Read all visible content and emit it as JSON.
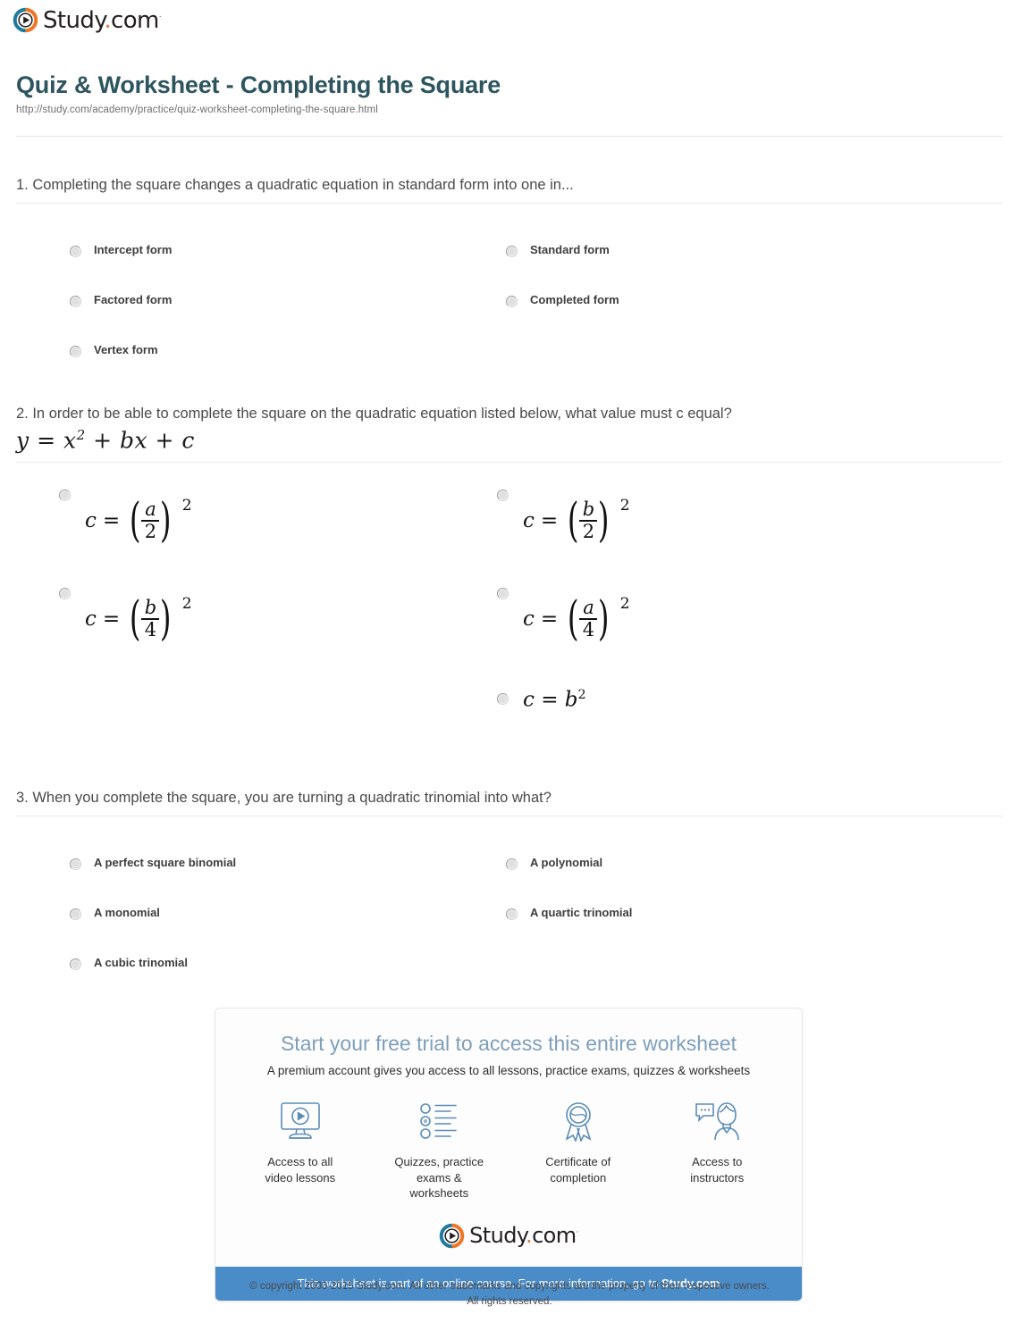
{
  "brand": {
    "name": "Study.com",
    "name_main": "Study",
    "name_dot": ".",
    "name_tld": "com",
    "trademark": "·",
    "logo_ring_left_color": "#1f7a9c",
    "logo_ring_right_color": "#ee7624",
    "logo_play_color": "#231f20"
  },
  "header": {
    "title": "Quiz & Worksheet - Completing the Square",
    "url": "http://study.com/academy/practice/quiz-worksheet-completing-the-square.html",
    "title_color": "#2d555e"
  },
  "questions": [
    {
      "number": "1.",
      "text": "1. Completing the square changes a quadratic equation in standard form into one in...",
      "options": [
        {
          "label": "Intercept form"
        },
        {
          "label": "Standard form"
        },
        {
          "label": "Factored form"
        },
        {
          "label": "Completed form"
        },
        {
          "label": "Vertex form"
        }
      ]
    },
    {
      "number": "2.",
      "text": "2. In order to be able to complete the square on the quadratic equation listed below, what value must c equal?",
      "equation": {
        "lhs": "y = x",
        "exponent": "2",
        "rhs": " + bx + c"
      },
      "math_options": [
        {
          "lhs": "c",
          "op": "=",
          "num": "a",
          "den": "2",
          "exp": "2",
          "kind": "fraction"
        },
        {
          "lhs": "c",
          "op": "=",
          "num": "b",
          "den": "2",
          "exp": "2",
          "kind": "fraction"
        },
        {
          "lhs": "c",
          "op": "=",
          "num": "b",
          "den": "4",
          "exp": "2",
          "kind": "fraction"
        },
        {
          "lhs": "c",
          "op": "=",
          "num": "a",
          "den": "4",
          "exp": "2",
          "kind": "fraction"
        },
        {
          "lhs": "c",
          "op": "=",
          "base": "b",
          "exp": "2",
          "kind": "power"
        }
      ]
    },
    {
      "number": "3.",
      "text": "3. When you complete the square, you are turning a quadratic trinomial into what?",
      "options": [
        {
          "label": "A perfect square binomial"
        },
        {
          "label": "A polynomial"
        },
        {
          "label": "A monomial"
        },
        {
          "label": "A quartic trinomial"
        },
        {
          "label": "A cubic trinomial"
        }
      ]
    }
  ],
  "promo": {
    "heading": "Start your free trial to access this entire worksheet",
    "subheading": "A premium account gives you access to all lessons, practice exams, quizzes & worksheets",
    "heading_color": "#7e9fba",
    "bar_color": "#4a8cc8",
    "features": [
      {
        "icon": "monitor-play-icon",
        "line1": "Access to all",
        "line2": "video lessons"
      },
      {
        "icon": "checklist-icon",
        "line1": "Quizzes, practice",
        "line2": "exams & worksheets"
      },
      {
        "icon": "award-ribbon-icon",
        "line1": "Certificate of",
        "line2": "completion"
      },
      {
        "icon": "instructor-chat-icon",
        "line1": "Access to",
        "line2": "instructors"
      }
    ],
    "bar_text_prefix": "This worksheet is part of an online course. For more information, go to ",
    "bar_text_brand": "Study.com"
  },
  "footer": {
    "line1": "© copyright 2003-2015 Study.com. All other trademarks and copyrights are the property of their respective owners.",
    "line2": "All rights reserved."
  }
}
